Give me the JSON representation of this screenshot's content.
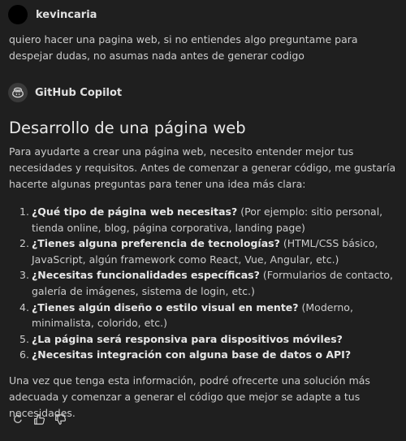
{
  "user": {
    "name": "kevincaria",
    "message": "quiero hacer una pagina web, si no entiendes algo preguntame para despejar dudas, no asumas nada antes de generar codigo"
  },
  "assistant": {
    "name": "GitHub Copilot",
    "title": "Desarrollo de una página web",
    "intro": "Para ayudarte a crear una página web, necesito entender mejor tus necesidades y requisitos. Antes de comenzar a generar código, me gustaría hacerte algunas preguntas para tener una idea más clara:",
    "questions": [
      {
        "num": "1.",
        "strong": "¿Qué tipo de página web necesitas?",
        "detail": " (Por ejemplo: sitio personal, tienda online, blog, página corporativa, landing page)"
      },
      {
        "num": "2.",
        "strong": "¿Tienes alguna preferencia de tecnologías?",
        "detail": " (HTML/CSS básico, JavaScript, algún framework como React, Vue, Angular, etc.)"
      },
      {
        "num": "3.",
        "strong": "¿Necesitas funcionalidades específicas?",
        "detail": " (Formularios de contacto, galería de imágenes, sistema de login, etc.)"
      },
      {
        "num": "4.",
        "strong": "¿Tienes algún diseño o estilo visual en mente?",
        "detail": " (Moderno, minimalista, colorido, etc.)"
      },
      {
        "num": "5.",
        "strong": "¿La página será responsiva para dispositivos móviles?",
        "detail": ""
      },
      {
        "num": "6.",
        "strong": "¿Necesitas integración con alguna base de datos o API?",
        "detail": ""
      }
    ],
    "closing": "Una vez que tenga esta información, podré ofrecerte una solución más adecuada y comenzar a generar el código que mejor se adapte a tus necesidades."
  },
  "actions": {
    "icons": [
      "retry-icon",
      "thumbs-up-icon",
      "thumbs-down-icon"
    ]
  },
  "colors": {
    "background": "#1f1f1f",
    "text": "#cccccc",
    "heading": "#e8e8e8"
  }
}
